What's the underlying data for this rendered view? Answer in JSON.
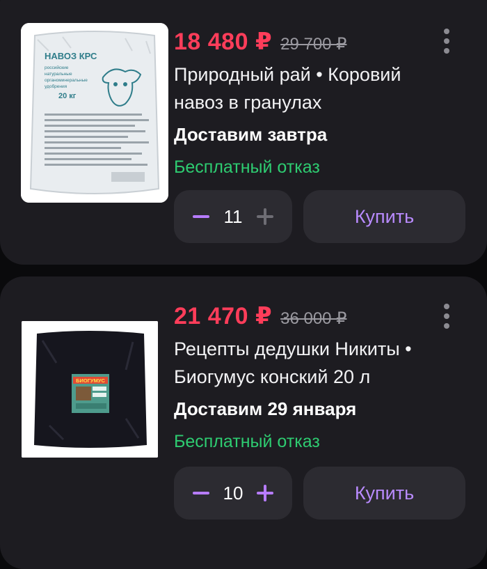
{
  "products": [
    {
      "price": "18 480 ₽",
      "old_price": "29 700 ₽",
      "title_line1": "Природный рай • Коровий",
      "title_line2": "навоз в гранулах",
      "delivery": "Доставим завтра",
      "refund": "Бесплатный отказ",
      "quantity": "11",
      "buy_label": "Купить",
      "image_text": {
        "brand": "НАВОЗ КРС",
        "line1": "российские",
        "line2": "натуральные",
        "line3": "органоминеральные",
        "line4": "удобрения",
        "weight": "20 кг"
      }
    },
    {
      "price": "21 470 ₽",
      "old_price": "36 000 ₽",
      "title_line1": "Рецепты дедушки Никиты •",
      "title_line2": "Биогумус конский 20 л",
      "delivery": "Доставим 29 января",
      "refund": "Бесплатный отказ",
      "quantity": "10",
      "buy_label": "Купить",
      "image_text": {
        "label": "БИОГУМУС"
      }
    }
  ],
  "colors": {
    "background": "#0a0a0c",
    "card": "#1d1c21",
    "price": "#ff3d5a",
    "refund": "#2ecc71",
    "accent": "#b77cff"
  }
}
